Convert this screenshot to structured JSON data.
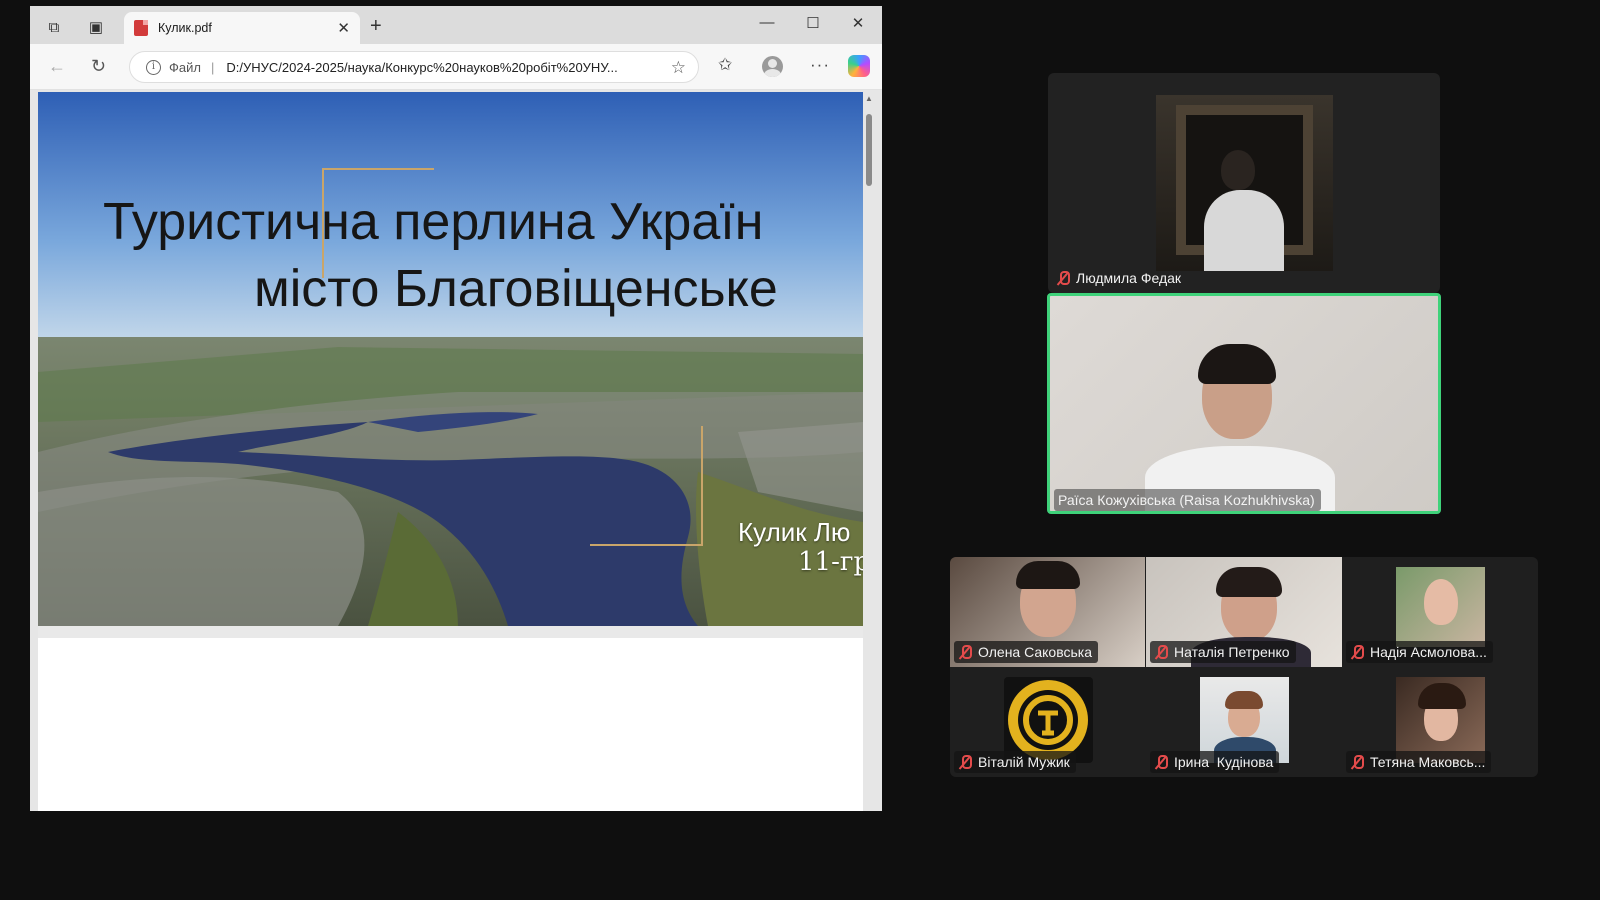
{
  "browser": {
    "tab_title": "Кулик.pdf",
    "address": {
      "file_label": "Файл",
      "url": "D:/УНУС/2024-2025/наука/Конкурс%20науков%20робіт%20УНУ..."
    }
  },
  "slide": {
    "title_line1": "Туристична перлина Україн",
    "title_line2": "місто Благовіщенське",
    "author": "Кулик Лю",
    "group": "11-гр"
  },
  "participants": {
    "featured_top": "Людмила Федак",
    "active_speaker": "Раїса Кожухівська (Raisa Kozhukhivska)",
    "grid": [
      "Олена Саковська",
      "Наталія Петренко",
      "Надія Асмолова...",
      "Віталій Мужик",
      "Ірина  Кудінова",
      "Тетяна Маковсь..."
    ]
  },
  "colors": {
    "active_speaker_border": "#3fd27a",
    "muted_mic": "#e34b4b",
    "background": "#0f0f0f"
  }
}
